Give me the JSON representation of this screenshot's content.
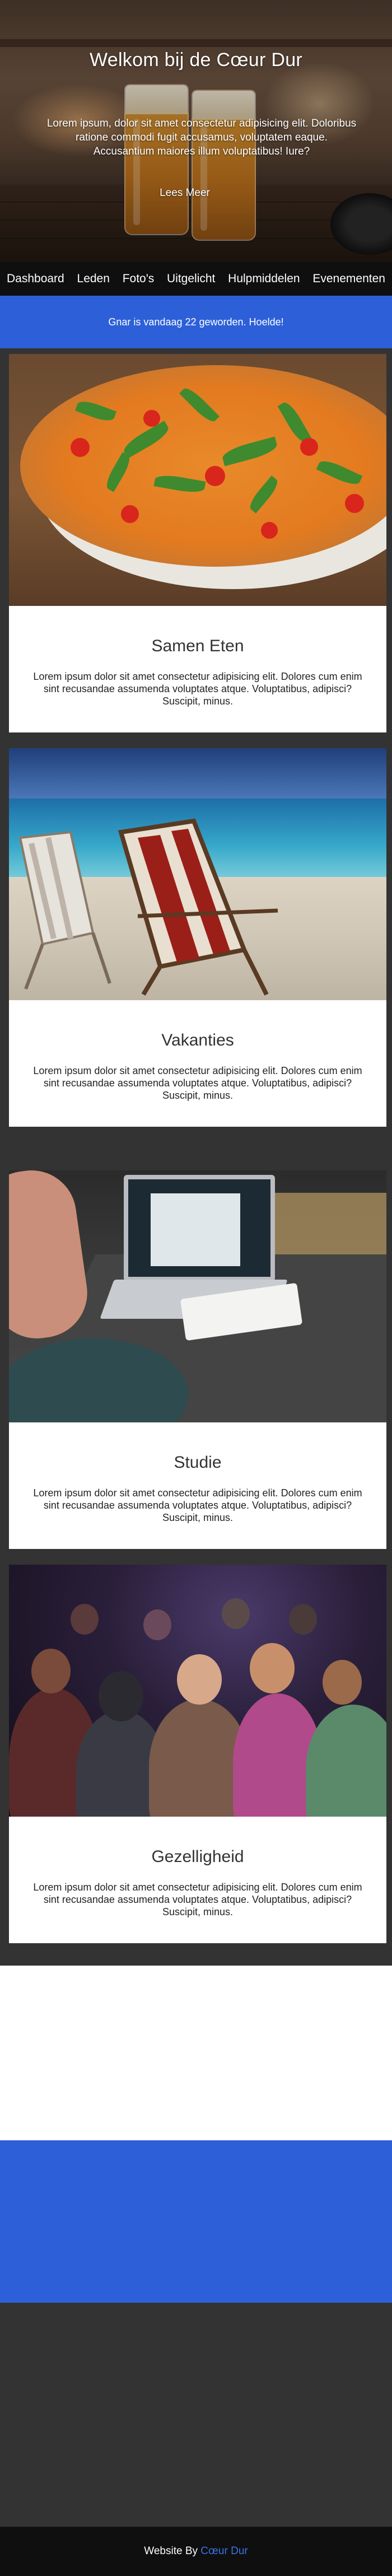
{
  "hero": {
    "title": "Welkom bij de Cœur Dur",
    "text": "Lorem ipsum, dolor sit amet consectetur adipisicing elit. Doloribus ratione commodi fugit accusamus, voluptatem eaque. Accusantium maiores illum voluptatibus! Iure?",
    "button": "Lees Meer"
  },
  "nav": {
    "items": [
      "Dashboard",
      "Leden",
      "Foto's",
      "Uitgelicht",
      "Hulpmiddelen",
      "Evenementen"
    ]
  },
  "banner": {
    "text": "Gnar is vandaag 22 geworden. Hoelde!"
  },
  "cards": [
    {
      "title": "Samen Eten",
      "text": "Lorem ipsum dolor sit amet consectetur adipisicing elit. Dolores cum enim sint recusandae assumenda voluptates atque. Voluptatibus, adipisci? Suscipit, minus."
    },
    {
      "title": "Vakanties",
      "text": "Lorem ipsum dolor sit amet consectetur adipisicing elit. Dolores cum enim sint recusandae assumenda voluptates atque. Voluptatibus, adipisci? Suscipit, minus."
    },
    {
      "title": "Studie",
      "text": "Lorem ipsum dolor sit amet consectetur adipisicing elit. Dolores cum enim sint recusandae assumenda voluptates atque. Voluptatibus, adipisci? Suscipit, minus."
    },
    {
      "title": "Gezelligheid",
      "text": "Lorem ipsum dolor sit amet consectetur adipisicing elit. Dolores cum enim sint recusandae assumenda voluptates atque. Voluptatibus, adipisci? Suscipit, minus."
    }
  ],
  "footer": {
    "prefix": "Website By ",
    "brand": "Cœur Dur"
  },
  "colors": {
    "accent_blue": "#2d60d8",
    "nav_bg": "#0f0f0f",
    "page_bg": "#333333",
    "footer_brand": "#3a72e8"
  }
}
